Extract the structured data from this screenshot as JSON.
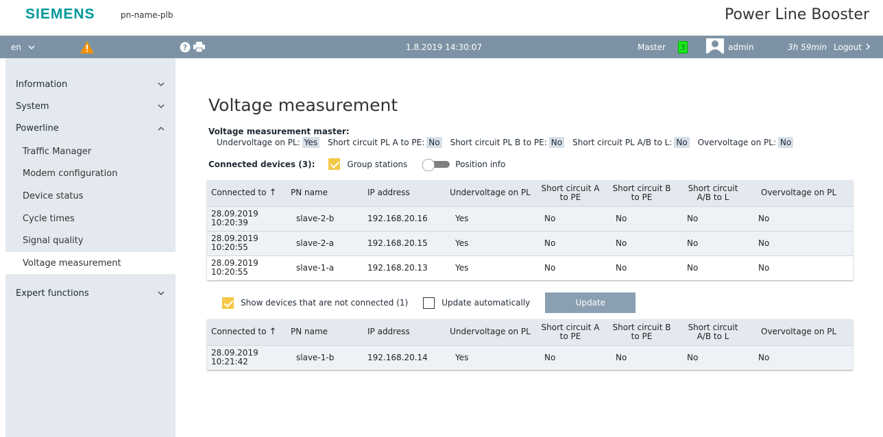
{
  "header": {
    "logo": "SIEMENS",
    "device_name": "pn-name-plb",
    "product_title": "Power Line Booster"
  },
  "navbar": {
    "language": "en",
    "datetime": "1.8.2019 14:30:07",
    "role": "Master",
    "device_count": "3",
    "user": "admin",
    "session_time": "3h 59min",
    "logout_label": "Logout"
  },
  "sidebar": {
    "items": [
      {
        "label": "Information",
        "chevron": "chevron-down"
      },
      {
        "label": "System",
        "chevron": "chevron-down"
      },
      {
        "label": "Powerline",
        "chevron": "chevron-up"
      },
      {
        "label": "Traffic Manager"
      },
      {
        "label": "Modem configuration"
      },
      {
        "label": "Device status"
      },
      {
        "label": "Cycle times"
      },
      {
        "label": "Signal quality"
      },
      {
        "label": "Voltage measurement"
      },
      {
        "label": "Expert functions",
        "chevron": "chevron-down"
      }
    ]
  },
  "main": {
    "title": "Voltage measurement",
    "master_heading": "Voltage measurement master:",
    "master_status": [
      {
        "label": "Undervoltage on PL:",
        "value": "Yes"
      },
      {
        "label": "Short circuit PL A to PE:",
        "value": "No"
      },
      {
        "label": "Short circuit PL B to PE:",
        "value": "No"
      },
      {
        "label": "Short circuit PL A/B to L:",
        "value": "No"
      },
      {
        "label": "Overvoltage on PL:",
        "value": "No"
      }
    ],
    "connected_label": "Connected devices (3):",
    "group_stations_label": "Group stations",
    "position_info_label": "Position info",
    "columns": [
      "Connected to",
      "PN name",
      "IP address",
      "Undervoltage on PL",
      "Short circuit A to PE",
      "Short circuit B to PE",
      "Short circuit A/B to L",
      "Overvoltage on PL"
    ],
    "connected_rows": [
      [
        "28.09.2019 10:20:39",
        "slave-2-b",
        "192.168.20.16",
        "Yes",
        "No",
        "No",
        "No",
        "No"
      ],
      [
        "28.09.2019 10:20:55",
        "slave-2-a",
        "192.168.20.15",
        "Yes",
        "No",
        "No",
        "No",
        "No"
      ],
      [
        "28.09.2019 10:20:55",
        "slave-1-a",
        "192.168.20.13",
        "Yes",
        "No",
        "No",
        "No",
        "No"
      ]
    ],
    "show_not_connected_label": "Show devices that are not connected (1)",
    "update_auto_label": "Update automatically",
    "update_button": "Update",
    "not_connected_rows": [
      [
        "28.09.2019 10:21:42",
        "slave-1-b",
        "192.168.20.14",
        "Yes",
        "No",
        "No",
        "No",
        "No"
      ]
    ]
  },
  "colors": {
    "brand": "#009999",
    "navbar": "#7d93a5",
    "sidebar": "#e4e9ef",
    "checkbox_on": "#f5c946",
    "count_badge": "#1be81b"
  }
}
